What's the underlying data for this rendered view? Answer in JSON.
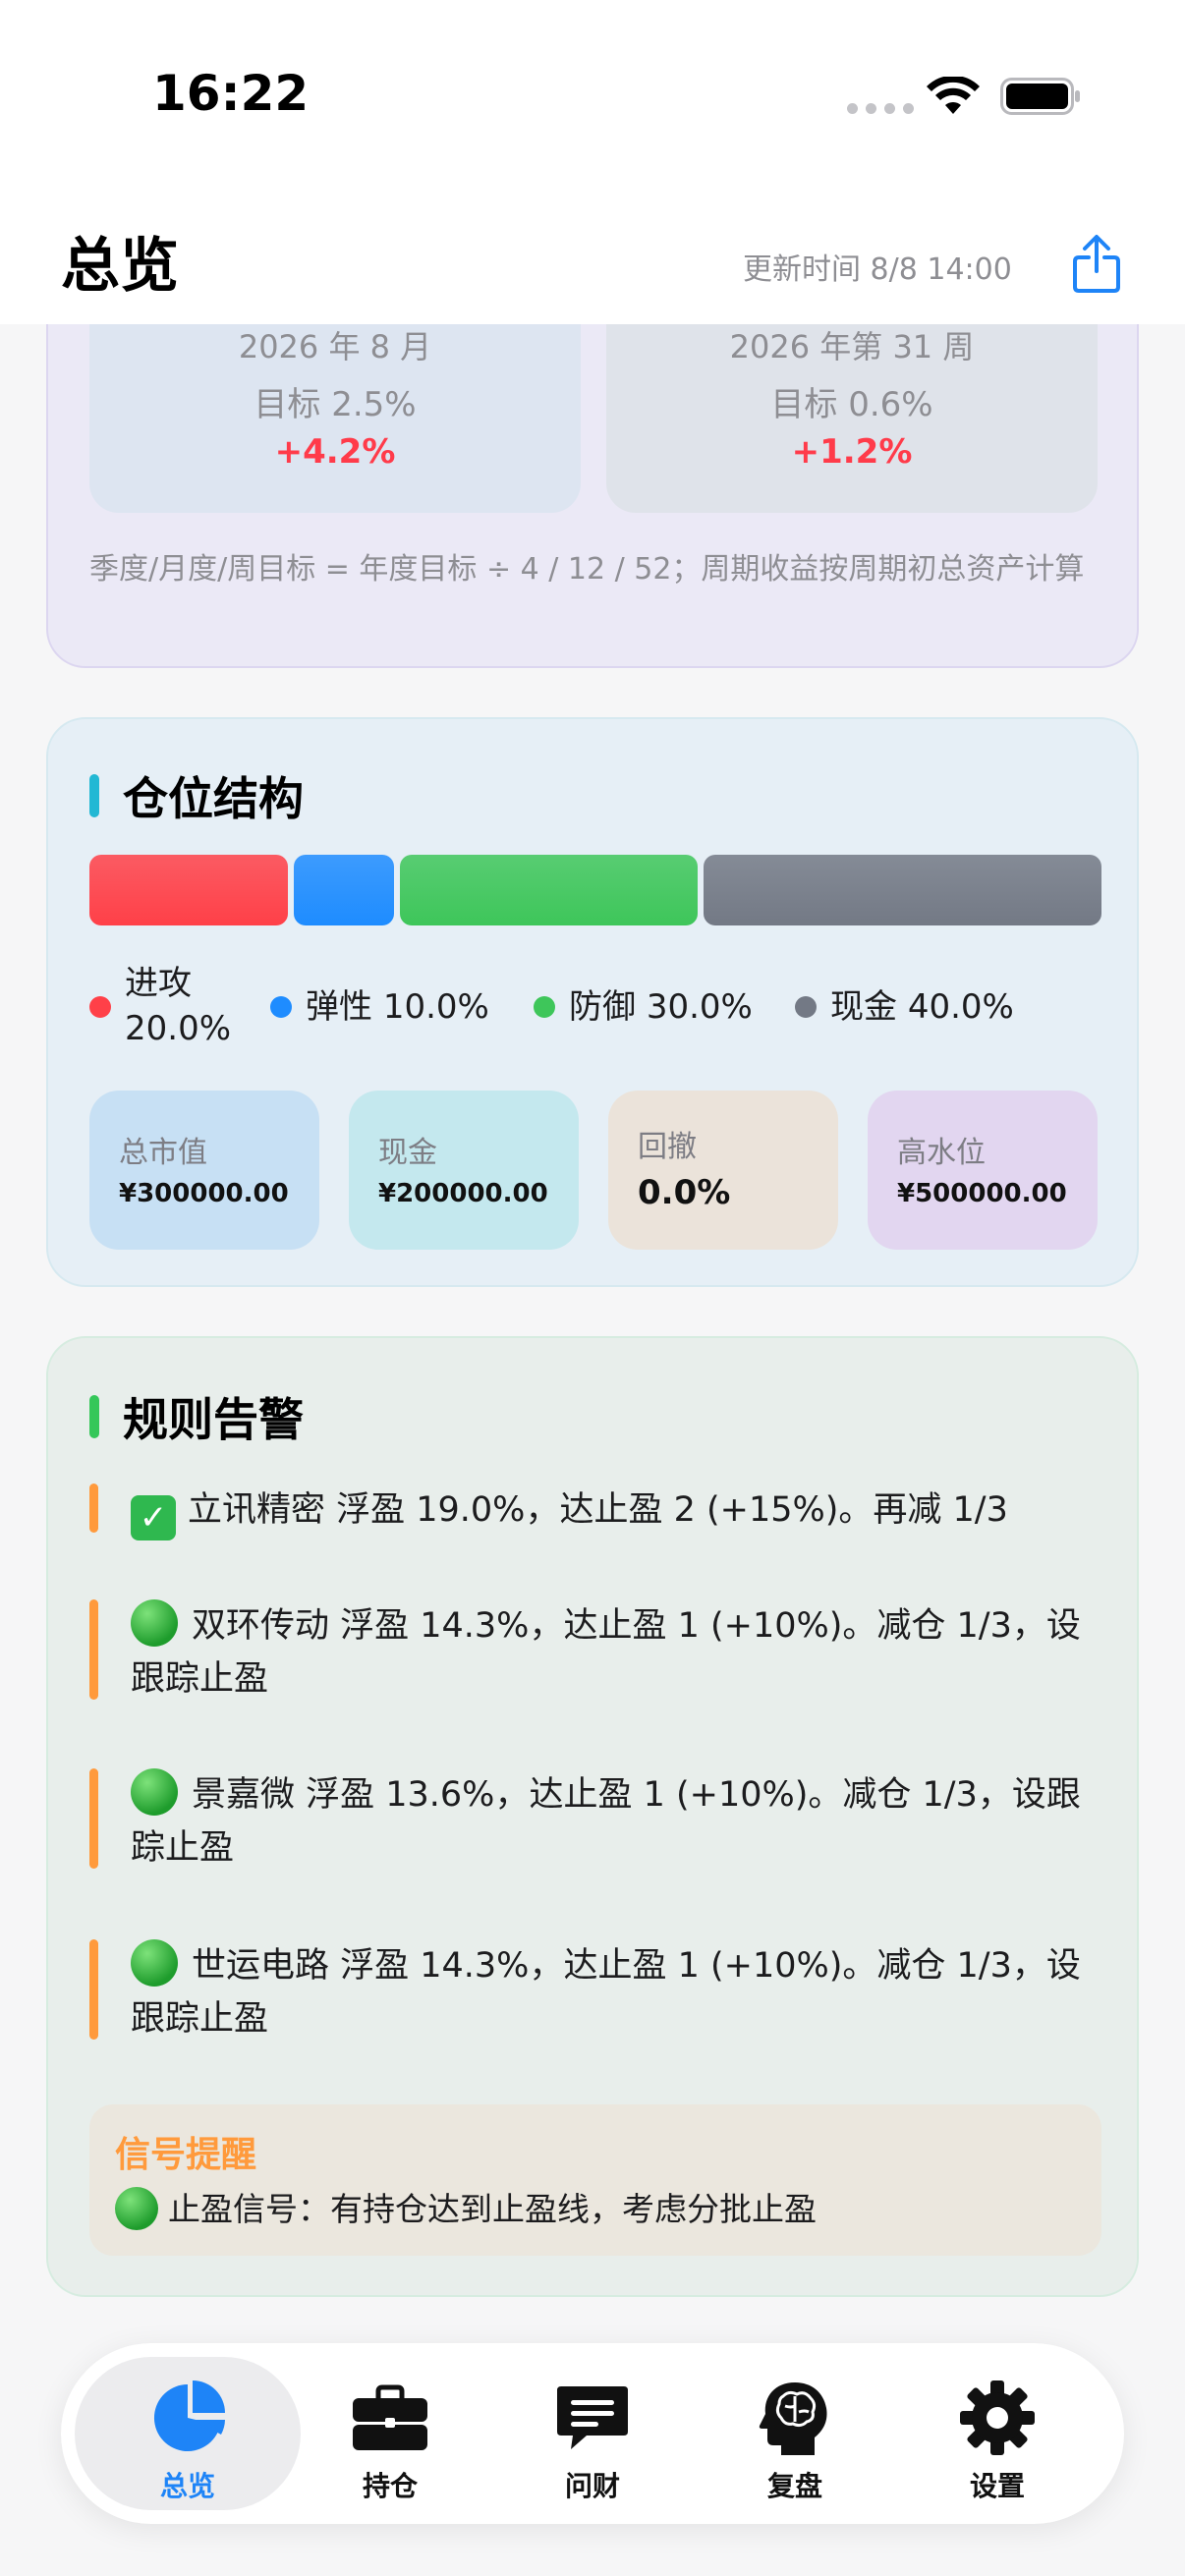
{
  "status_bar": {
    "time": "16:22"
  },
  "header": {
    "title": "总览",
    "update_time": "更新时间 8/8 14:00"
  },
  "goals": {
    "month": {
      "period": "2026 年 8 月",
      "target": "目标 2.5%",
      "return": "+4.2%"
    },
    "week": {
      "period": "2026 年第 31 周",
      "target": "目标 0.6%",
      "return": "+1.2%"
    },
    "note": "季度/月度/周目标 = 年度目标 ÷ 4 / 12 / 52；周期收益按周期初总资产计算",
    "return_color": "#ff3b4a"
  },
  "position_structure": {
    "title": "仓位结构",
    "accent": "#22b8d4",
    "segments": [
      {
        "name": "进攻",
        "percent": "20.0%",
        "fraction": 0.2,
        "color": "#ff4048"
      },
      {
        "name": "弹性",
        "percent": "10.0%",
        "fraction": 0.1,
        "color": "#1e8cff"
      },
      {
        "name": "防御",
        "percent": "30.0%",
        "fraction": 0.3,
        "color": "#3ec65a"
      },
      {
        "name": "现金",
        "percent": "40.0%",
        "fraction": 0.4,
        "color": "#737985"
      }
    ],
    "metrics": [
      {
        "label": "总市值",
        "value": "¥300000.00",
        "color": "#c7e0f4"
      },
      {
        "label": "现金",
        "value": "¥200000.00",
        "color": "#c4e8ee"
      },
      {
        "label": "回撤",
        "value": "0.0%",
        "color": "#ebe3da"
      },
      {
        "label": "高水位",
        "value": "¥500000.00",
        "color": "#e2d6f0"
      }
    ]
  },
  "rule_alerts": {
    "title": "规则告警",
    "accent": "#34c759",
    "items": [
      {
        "icon": "check-mark-icon",
        "text": "立讯精密 浮盈 19.0%，达止盈 2 (+15%)。再减 1/3"
      },
      {
        "icon": "green-circle-icon",
        "text": "双环传动 浮盈 14.3%，达止盈 1 (+10%)。减仓 1/3，设跟踪止盈"
      },
      {
        "icon": "green-circle-icon",
        "text": "景嘉微 浮盈 13.6%，达止盈 1 (+10%)。减仓 1/3，设跟踪止盈"
      },
      {
        "icon": "green-circle-icon",
        "text": "世运电路 浮盈 14.3%，达止盈 1 (+10%)。减仓 1/3，设跟踪止盈"
      }
    ],
    "signal": {
      "title": "信号提醒",
      "text": "止盈信号：有持仓达到止盈线，考虑分批止盈"
    }
  },
  "tab_bar": {
    "active_color": "#1e84f7",
    "tabs": [
      {
        "label": "总览",
        "icon": "pie-chart-icon",
        "active": true
      },
      {
        "label": "持仓",
        "icon": "briefcase-icon",
        "active": false
      },
      {
        "label": "问财",
        "icon": "chat-bubble-icon",
        "active": false
      },
      {
        "label": "复盘",
        "icon": "brain-head-icon",
        "active": false
      },
      {
        "label": "设置",
        "icon": "gear-icon",
        "active": false
      }
    ]
  }
}
